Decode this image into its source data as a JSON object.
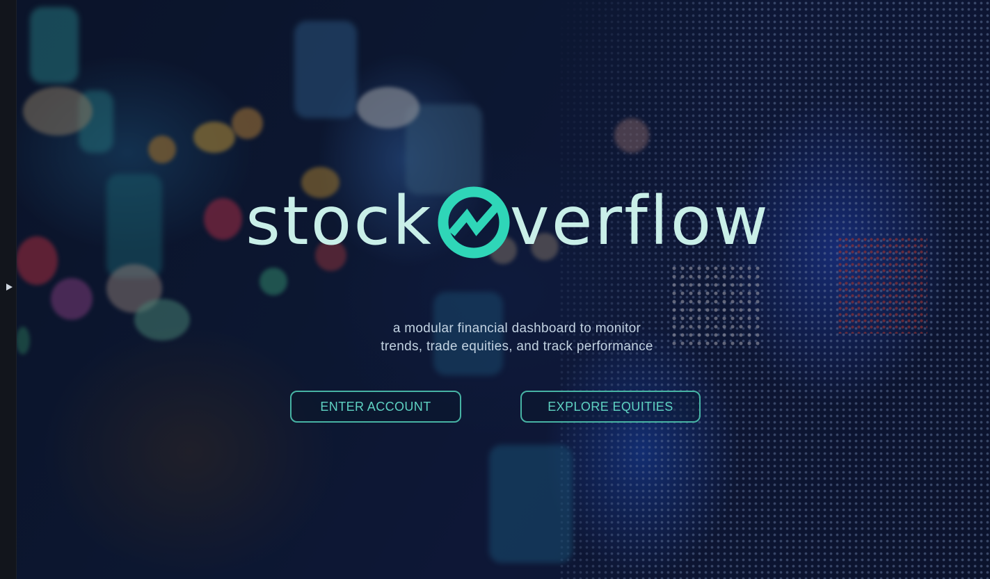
{
  "brand": {
    "name_left": "stock",
    "name_right": "verflow",
    "logo_icon": "trend-circle-icon",
    "accent_color": "#2fd6b8",
    "text_color": "#c9efe8"
  },
  "hero": {
    "tagline_line1": "a modular financial dashboard to monitor",
    "tagline_line2": "trends, trade equities, and track performance"
  },
  "actions": {
    "enter_account": "ENTER ACCOUNT",
    "explore_equities": "EXPLORE EQUITIES",
    "button_border_color": "#47b3a4"
  },
  "sidebar": {
    "toggle_icon": "play-triangle-icon"
  }
}
